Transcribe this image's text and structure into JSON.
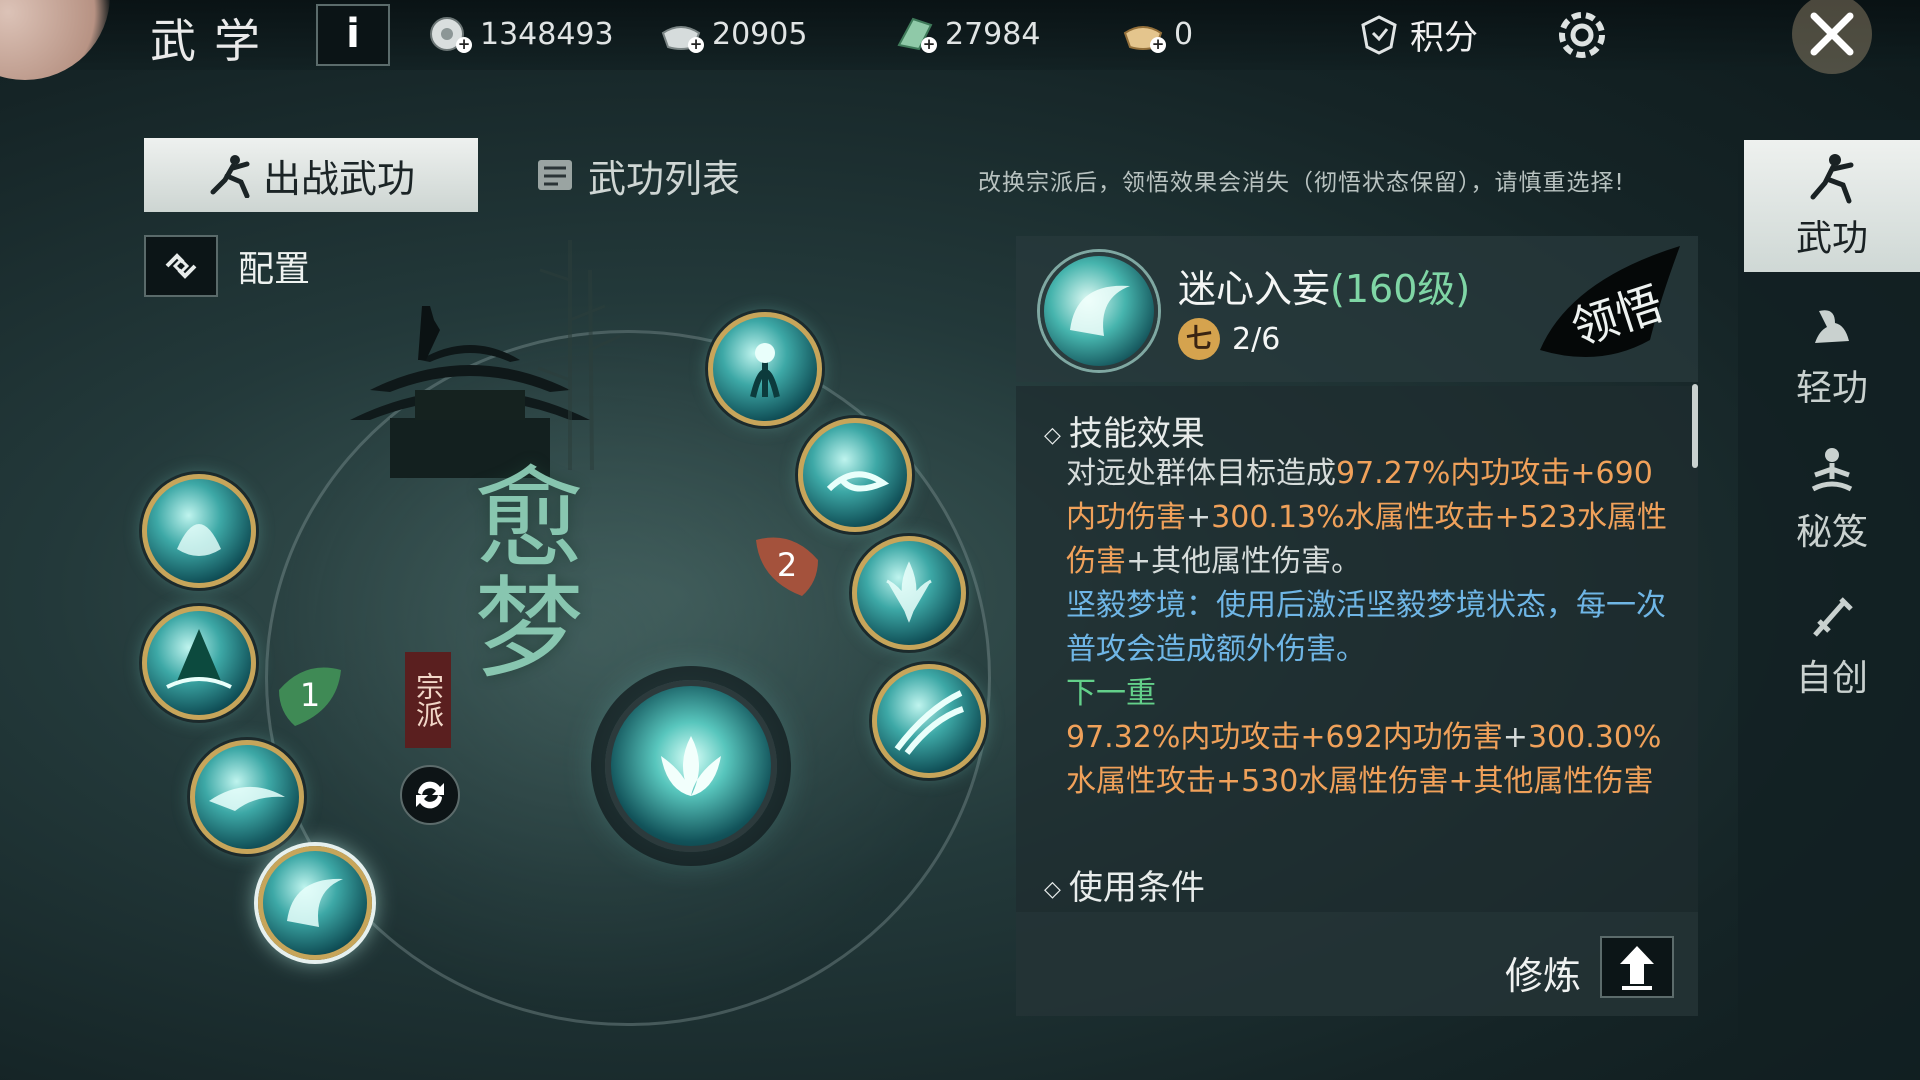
{
  "header": {
    "title": "武学",
    "info_label": "i",
    "currencies": [
      {
        "icon": "silver-coin-icon",
        "value": "1348493"
      },
      {
        "icon": "silver-ingot-icon",
        "value": "20905"
      },
      {
        "icon": "jade-icon",
        "value": "27984"
      },
      {
        "icon": "gold-ingot-icon",
        "value": "0"
      }
    ],
    "score_label": "积分",
    "settings_icon": "gear-icon",
    "close_icon": "close-icon"
  },
  "tabs": [
    {
      "label": "出战武功",
      "active": true
    },
    {
      "label": "武功列表",
      "active": false
    }
  ],
  "warning": "改换宗派后，领悟效果会消失（彻悟状态保留），请慎重选择!",
  "config_label": "配置",
  "wheel": {
    "school_name": "愈梦",
    "school_tag": "宗派",
    "page_left": "1",
    "page_right": "2"
  },
  "detail": {
    "skill_name": "迷心入妄",
    "skill_level": "(160级)",
    "rank_char": "七",
    "rank_value": "2/6",
    "enlight_badge": "领悟",
    "section_effect": "技能效果",
    "effect_p1_a": "对远处群体目标造成",
    "effect_p1_b": "97.27%内功攻击+690内功伤害",
    "effect_p1_c": "+",
    "effect_p1_d": "300.13%水属性攻击+523水属性伤害",
    "effect_p1_e": "+其他属性伤害。",
    "effect_p2": "坚毅梦境：使用后激活坚毅梦境状态，每一次普攻会造成额外伤害。",
    "next_label": "下一重",
    "next_a": "97.32%内功攻击+692内功伤害",
    "next_b": "+",
    "next_c": "300.30%水属性攻击+530水属性伤害+其他属性伤害",
    "section_use": "使用条件",
    "train_label": "修炼"
  },
  "nav": [
    {
      "label": "武功",
      "icon": "martial-artist-icon",
      "active": true
    },
    {
      "label": "轻功",
      "icon": "light-foot-icon",
      "active": false
    },
    {
      "label": "秘笈",
      "icon": "meditation-icon",
      "active": false
    },
    {
      "label": "自创",
      "icon": "sword-create-icon",
      "active": false
    }
  ],
  "colors": {
    "accent_orange": "#f0a15a",
    "accent_blue": "#6fb6e6",
    "accent_green": "#63d08a",
    "level_green": "#7fd6a5",
    "skill_ring_gold": "#c7a55a"
  }
}
